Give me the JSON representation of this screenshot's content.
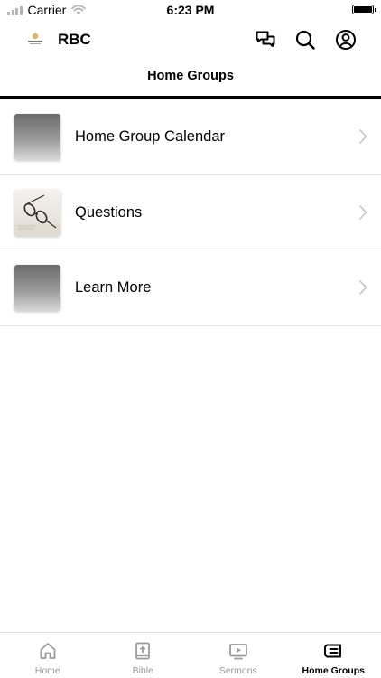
{
  "status_bar": {
    "carrier": "Carrier",
    "time": "6:23 PM",
    "icons": [
      "signal-icon",
      "wifi-icon",
      "battery-icon"
    ]
  },
  "header": {
    "logo_icon": "church-logo-icon",
    "title": "RBC",
    "actions": [
      {
        "name": "chat-icon"
      },
      {
        "name": "search-icon"
      },
      {
        "name": "profile-icon"
      }
    ]
  },
  "page": {
    "title": "Home Groups"
  },
  "list": {
    "items": [
      {
        "label": "Home Group Calendar",
        "thumb": "gradient"
      },
      {
        "label": "Questions",
        "thumb": "photo-glasses"
      },
      {
        "label": "Learn More",
        "thumb": "gradient"
      }
    ]
  },
  "tabs": [
    {
      "label": "Home",
      "icon": "home-icon",
      "active": false
    },
    {
      "label": "Bible",
      "icon": "bible-icon",
      "active": false
    },
    {
      "label": "Sermons",
      "icon": "video-icon",
      "active": false
    },
    {
      "label": "Home Groups",
      "icon": "groups-icon",
      "active": true
    }
  ],
  "colors": {
    "active_tab": "#000000",
    "inactive_tab": "#9a9a9a",
    "divider": "#e6e6e6",
    "chevron": "#c4c4c4"
  }
}
